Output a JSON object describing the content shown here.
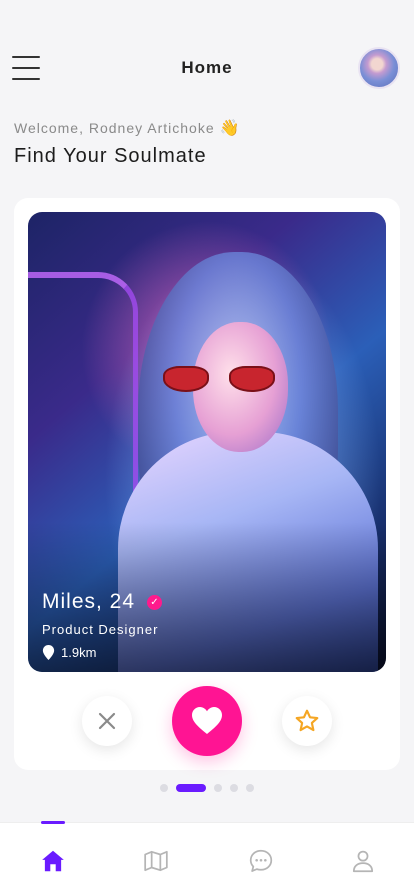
{
  "header": {
    "title": "Home"
  },
  "welcome": {
    "greeting": "Welcome, Rodney Artichoke",
    "wave_emoji": "👋",
    "headline": "Find Your Soulmate"
  },
  "profile": {
    "name_age": "Miles, 24",
    "job": "Product Designer",
    "distance": "1.9km",
    "verified_glyph": "✓"
  },
  "pagination": {
    "total": 5,
    "active_index": 1
  },
  "bottom_nav": {
    "items": [
      "home-icon",
      "map-icon",
      "chat-icon",
      "profile-icon"
    ],
    "active": "home-icon"
  },
  "colors": {
    "accent": "#6a1bff",
    "like": "#ff1493",
    "star": "#f5a623",
    "dislike": "#8a8a8a",
    "nav_inactive": "#b5b5b5"
  }
}
